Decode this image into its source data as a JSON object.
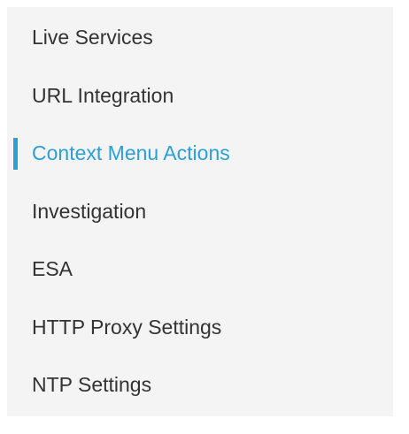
{
  "sidebar": {
    "accent_color": "#2b9fd6",
    "text_color": "#333333",
    "background_color": "#f4f4f4",
    "active_index": 2,
    "items": [
      {
        "label": "Live Services"
      },
      {
        "label": "URL Integration"
      },
      {
        "label": "Context Menu Actions"
      },
      {
        "label": "Investigation"
      },
      {
        "label": "ESA"
      },
      {
        "label": "HTTP Proxy Settings"
      },
      {
        "label": "NTP Settings"
      }
    ]
  }
}
